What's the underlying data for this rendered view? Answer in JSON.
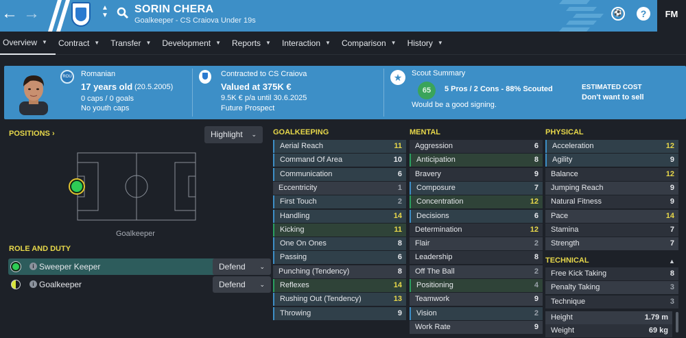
{
  "header": {
    "player_name": "SORIN CHERA",
    "subtitle": "Goalkeeper - CS Craiova Under 19s",
    "fm_label": "FM",
    "help_label": "?"
  },
  "tabs": [
    {
      "label": "Overview"
    },
    {
      "label": "Contract"
    },
    {
      "label": "Transfer"
    },
    {
      "label": "Development"
    },
    {
      "label": "Reports"
    },
    {
      "label": "Interaction"
    },
    {
      "label": "Comparison"
    },
    {
      "label": "History"
    }
  ],
  "info": {
    "nationality": "Romanian",
    "nation_code": "ROU",
    "age": "17 years old",
    "dob": "(20.5.2005)",
    "caps": "0 caps / 0 goals",
    "youth_caps": "No youth caps",
    "contract_label": "Contracted to CS Craiova",
    "value": "Valued at 375K €",
    "wage": "9.5K € p/a until 30.6.2025",
    "prospect": "Future Prospect",
    "scout_label": "Scout Summary",
    "scout_score": "65",
    "scout_pros": "5 Pros / 2 Cons - 88% Scouted",
    "scout_verdict": "Would be a good signing.",
    "cost_label": "ESTIMATED COST",
    "cost_value": "Don't want to sell"
  },
  "positions": {
    "title": "POSITIONS",
    "highlight": "Highlight",
    "position_label": "Goalkeeper"
  },
  "roles": {
    "title": "ROLE AND DUTY",
    "items": [
      {
        "name": "Sweeper Keeper",
        "duty": "Defend"
      },
      {
        "name": "Goalkeeper",
        "duty": "Defend"
      }
    ]
  },
  "attributes": {
    "goalkeeping": {
      "title": "GOALKEEPING",
      "rows": [
        {
          "name": "Aerial Reach",
          "value": "11"
        },
        {
          "name": "Command Of Area",
          "value": "10"
        },
        {
          "name": "Communication",
          "value": "6"
        },
        {
          "name": "Eccentricity",
          "value": "1"
        },
        {
          "name": "First Touch",
          "value": "2"
        },
        {
          "name": "Handling",
          "value": "14"
        },
        {
          "name": "Kicking",
          "value": "11"
        },
        {
          "name": "One On Ones",
          "value": "8"
        },
        {
          "name": "Passing",
          "value": "6"
        },
        {
          "name": "Punching (Tendency)",
          "value": "8"
        },
        {
          "name": "Reflexes",
          "value": "14"
        },
        {
          "name": "Rushing Out (Tendency)",
          "value": "13"
        },
        {
          "name": "Throwing",
          "value": "9"
        }
      ]
    },
    "mental": {
      "title": "MENTAL",
      "rows": [
        {
          "name": "Aggression",
          "value": "6"
        },
        {
          "name": "Anticipation",
          "value": "8"
        },
        {
          "name": "Bravery",
          "value": "9"
        },
        {
          "name": "Composure",
          "value": "7"
        },
        {
          "name": "Concentration",
          "value": "12"
        },
        {
          "name": "Decisions",
          "value": "6"
        },
        {
          "name": "Determination",
          "value": "12"
        },
        {
          "name": "Flair",
          "value": "2"
        },
        {
          "name": "Leadership",
          "value": "8"
        },
        {
          "name": "Off The Ball",
          "value": "2"
        },
        {
          "name": "Positioning",
          "value": "4"
        },
        {
          "name": "Teamwork",
          "value": "9"
        },
        {
          "name": "Vision",
          "value": "2"
        },
        {
          "name": "Work Rate",
          "value": "9"
        }
      ]
    },
    "physical": {
      "title": "PHYSICAL",
      "rows": [
        {
          "name": "Acceleration",
          "value": "12"
        },
        {
          "name": "Agility",
          "value": "9"
        },
        {
          "name": "Balance",
          "value": "12"
        },
        {
          "name": "Jumping Reach",
          "value": "9"
        },
        {
          "name": "Natural Fitness",
          "value": "9"
        },
        {
          "name": "Pace",
          "value": "14"
        },
        {
          "name": "Stamina",
          "value": "7"
        },
        {
          "name": "Strength",
          "value": "7"
        }
      ]
    },
    "technical": {
      "title": "TECHNICAL",
      "rows": [
        {
          "name": "Free Kick Taking",
          "value": "8"
        },
        {
          "name": "Penalty Taking",
          "value": "3"
        },
        {
          "name": "Technique",
          "value": "3"
        }
      ]
    },
    "bio": [
      {
        "name": "Height",
        "value": "1.79 m"
      },
      {
        "name": "Weight",
        "value": "69 kg"
      }
    ]
  }
}
